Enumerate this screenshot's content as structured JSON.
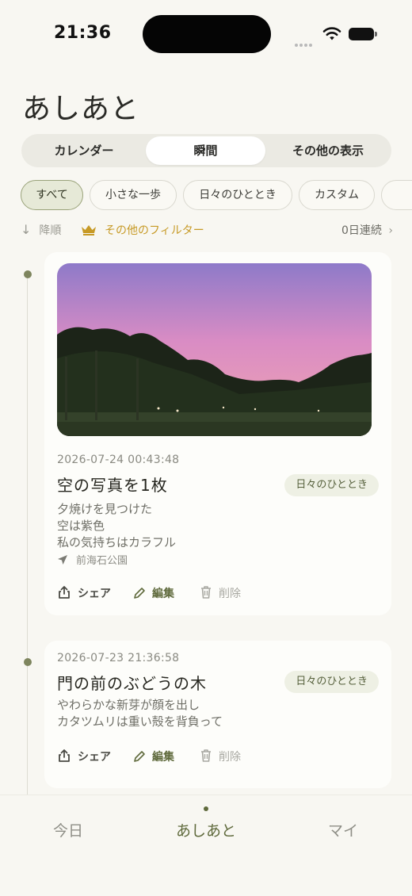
{
  "status_bar": {
    "time": "21:36"
  },
  "page": {
    "title": "あしあと"
  },
  "segments": [
    {
      "label": "カレンダー",
      "active": false
    },
    {
      "label": "瞬間",
      "active": true
    },
    {
      "label": "その他の表示",
      "active": false
    }
  ],
  "filters": [
    {
      "label": "すべて",
      "active": true
    },
    {
      "label": "小さな一歩",
      "active": false
    },
    {
      "label": "日々のひととき",
      "active": false
    },
    {
      "label": "カスタム",
      "active": false
    }
  ],
  "toolbar": {
    "sort_label": "降順",
    "more_filters_label": "その他のフィルター",
    "streak_label": "0日連続",
    "accent_color": "#c79a26"
  },
  "entries": [
    {
      "timestamp": "2026-07-24 00:43:48",
      "title": "空の写真を1枚",
      "tag": "日々のひととき",
      "lines": [
        "夕焼けを見つけた",
        "空は紫色",
        "私の気持ちはカラフル"
      ],
      "location": "前海石公園",
      "has_photo": true,
      "actions": {
        "share": "シェア",
        "edit": "編集",
        "delete": "削除"
      }
    },
    {
      "timestamp": "2026-07-23 21:36:58",
      "title": "門の前のぶどうの木",
      "tag": "日々のひととき",
      "lines": [
        "やわらかな新芽が顔を出し",
        "カタツムリは重い殻を背負って"
      ],
      "has_photo": false,
      "actions": {
        "share": "シェア",
        "edit": "編集",
        "delete": "削除"
      }
    }
  ],
  "tabbar": {
    "items": [
      {
        "label": "今日",
        "active": false
      },
      {
        "label": "あしあと",
        "active": true
      },
      {
        "label": "マイ",
        "active": false
      }
    ],
    "active_color": "#5f6a3c"
  }
}
